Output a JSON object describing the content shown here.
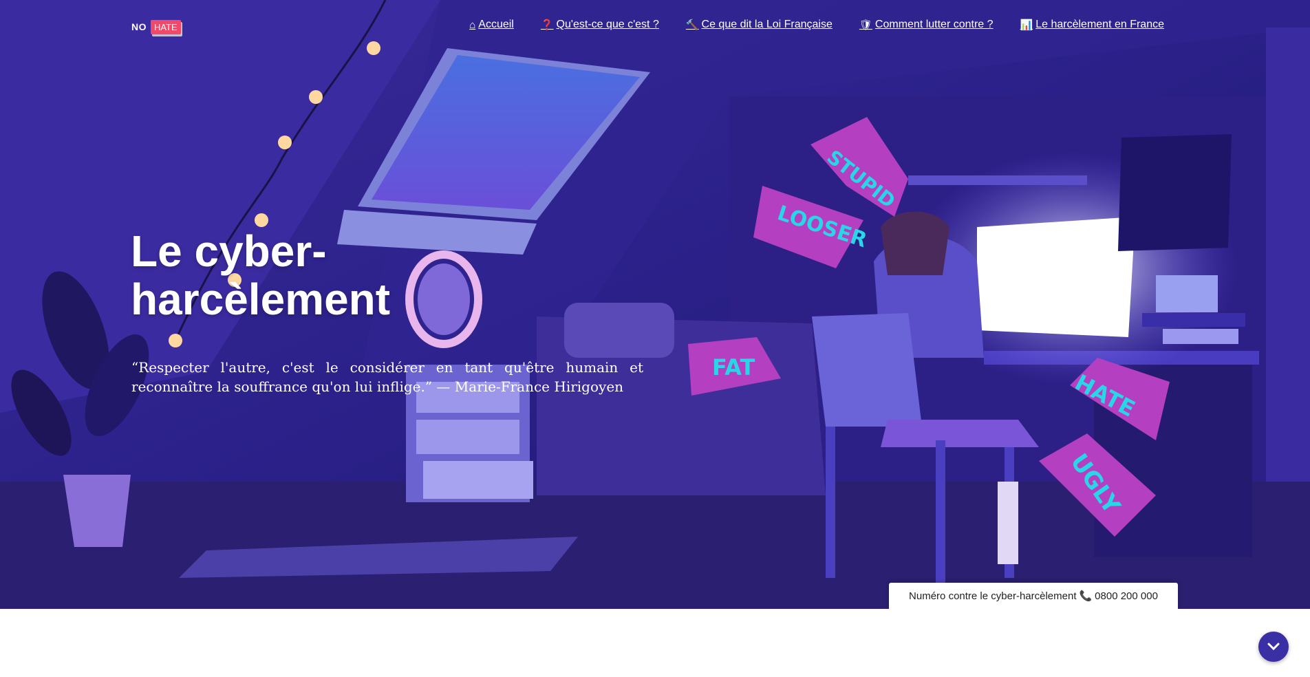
{
  "logo": {
    "no": "NO",
    "hate": "HATE"
  },
  "nav": {
    "items": [
      {
        "icon": "home-icon",
        "label": "Accueil"
      },
      {
        "icon": "question-icon",
        "label": "Qu'est-ce que c'est ?"
      },
      {
        "icon": "gavel-icon",
        "label": "Ce que dit la Loi Française"
      },
      {
        "icon": "shield-icon",
        "label": "Comment lutter contre ?"
      },
      {
        "icon": "bar-chart-icon",
        "label": "Le harcèlement en France"
      }
    ]
  },
  "hero": {
    "title": "Le cyber-harcèlement",
    "quote": "“Respecter l'autre, c'est le considérer en tant qu'être humain et reconnaître la souffrance qu'on lui inflige.” — Marie-France Hirigoyen",
    "signs": [
      "STUPID",
      "LOOSER",
      "FAT",
      "HATE",
      "UGLY"
    ]
  },
  "hotline": {
    "label": "Numéro contre le cyber-harcèlement",
    "number": "0800 200 000",
    "icon": "phone-icon"
  },
  "scroll_button": {
    "icon": "chevron-down-icon"
  },
  "colors": {
    "hero_bg": "#2b1f7a",
    "accent_pink": "#c43bb8",
    "sign_text": "#29d6e8",
    "logo_red": "#ef4a6a",
    "button": "#3b2fa6"
  }
}
